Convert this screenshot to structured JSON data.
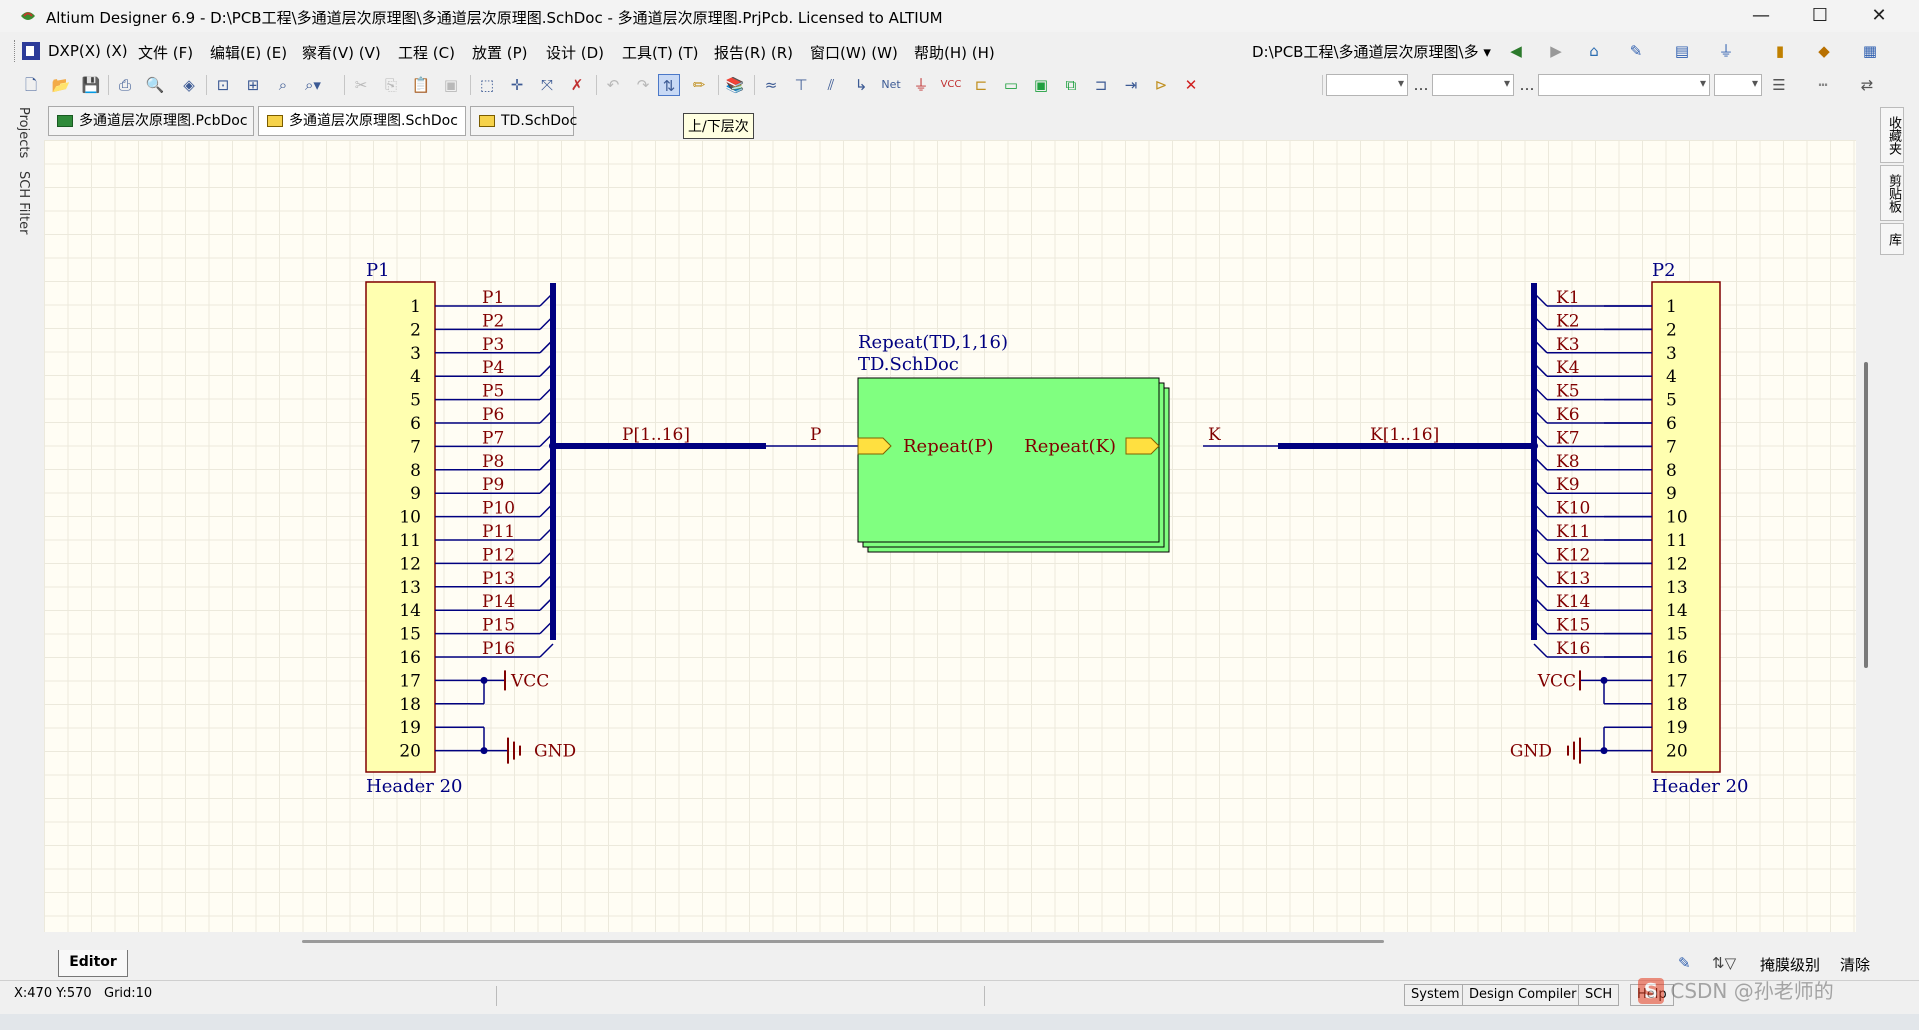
{
  "window": {
    "title": "Altium Designer 6.9 - D:\\PCB工程\\多通道层次原理图\\多通道层次原理图.SchDoc - 多通道层次原理图.PrjPcb. Licensed to ALTIUM",
    "minimize": "—",
    "maximize": "☐",
    "close": "✕"
  },
  "menu": {
    "items": [
      "DXP(X) (X)",
      "文件 (F)",
      "编辑(E) (E)",
      "察看(V) (V)",
      "工程 (C)",
      "放置 (P)",
      "设计 (D)",
      "工具(T) (T)",
      "报告(R) (R)",
      "窗口(W) (W)",
      "帮助(H) (H)"
    ],
    "path_combo": "D:\\PCB工程\\多通道层次原理图\\多 ▾"
  },
  "tabs": [
    {
      "label": "多通道层次原理图.PcbDoc",
      "icon": "pcb-doc-icon"
    },
    {
      "label": "多通道层次原理图.SchDoc",
      "icon": "sch-doc-icon"
    },
    {
      "label": "TD.SchDoc",
      "icon": "sch-doc-icon"
    }
  ],
  "tooltip": "上/下层次",
  "left_panel": {
    "projects": "Projects",
    "sch_filter": "SCH Filter"
  },
  "right_panel": [
    "收藏夹",
    "剪贴板",
    "库"
  ],
  "schematic": {
    "p1": {
      "designator": "P1",
      "comment": "Header 20",
      "pins": [
        "1",
        "2",
        "3",
        "4",
        "5",
        "6",
        "7",
        "8",
        "9",
        "10",
        "11",
        "12",
        "13",
        "14",
        "15",
        "16",
        "17",
        "18",
        "19",
        "20"
      ],
      "nets": [
        "P1",
        "P2",
        "P3",
        "P4",
        "P5",
        "P6",
        "P7",
        "P8",
        "P9",
        "P10",
        "P11",
        "P12",
        "P13",
        "P14",
        "P15",
        "P16"
      ],
      "bus_label": "P[1..16]"
    },
    "p2": {
      "designator": "P2",
      "comment": "Header 20",
      "pins": [
        "1",
        "2",
        "3",
        "4",
        "5",
        "6",
        "7",
        "8",
        "9",
        "10",
        "11",
        "12",
        "13",
        "14",
        "15",
        "16",
        "17",
        "18",
        "19",
        "20"
      ],
      "nets": [
        "K1",
        "K2",
        "K3",
        "K4",
        "K5",
        "K6",
        "K7",
        "K8",
        "K9",
        "K10",
        "K11",
        "K12",
        "K13",
        "K14",
        "K15",
        "K16"
      ],
      "bus_label": "K[1..16]"
    },
    "sheet": {
      "designator": "Repeat(TD,1,16)",
      "filename": "TD.SchDoc",
      "entry_left": "Repeat(P)",
      "entry_right": "Repeat(K)",
      "fill": "#80ff80"
    },
    "net_left": "P",
    "net_right": "K",
    "power_vcc": "VCC",
    "power_gnd": "GND",
    "wire_color": "#000080",
    "label_color": "#800000",
    "body_fill": "#ffffb0"
  },
  "editor": {
    "tab": "Editor",
    "mask_level": "掩膜级别",
    "clear": "清除"
  },
  "status": {
    "coords": "X:470 Y:570",
    "grid": "Grid:10",
    "panels": [
      "System",
      "Design Compiler",
      "SCH",
      "Help"
    ]
  },
  "watermark": "CSDN @孙老师的"
}
